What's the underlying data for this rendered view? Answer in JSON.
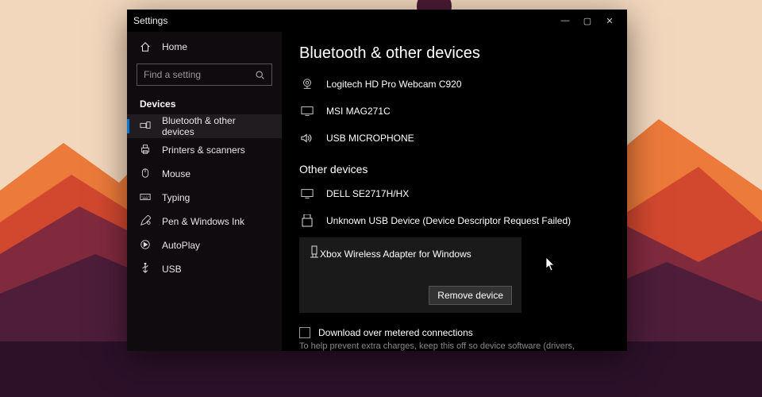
{
  "window": {
    "title": "Settings",
    "controls": {
      "min": "—",
      "max": "▢",
      "close": "✕"
    }
  },
  "sidebar": {
    "home_label": "Home",
    "search_placeholder": "Find a setting",
    "category_header": "Devices",
    "items": [
      {
        "label": "Bluetooth & other devices",
        "icon": "bluetooth-devices-icon",
        "active": true
      },
      {
        "label": "Printers & scanners",
        "icon": "printer-icon"
      },
      {
        "label": "Mouse",
        "icon": "mouse-icon"
      },
      {
        "label": "Typing",
        "icon": "typing-icon"
      },
      {
        "label": "Pen & Windows Ink",
        "icon": "pen-icon"
      },
      {
        "label": "AutoPlay",
        "icon": "autoplay-icon"
      },
      {
        "label": "USB",
        "icon": "usb-icon"
      }
    ]
  },
  "main": {
    "heading": "Bluetooth & other devices",
    "top_devices": [
      {
        "label": "Logitech HD Pro Webcam C920",
        "icon": "webcam-icon"
      },
      {
        "label": "MSI MAG271C",
        "icon": "monitor-icon"
      },
      {
        "label": "USB MICROPHONE",
        "icon": "audio-icon"
      }
    ],
    "other_heading": "Other devices",
    "other_devices": [
      {
        "label": "DELL SE2717H/HX",
        "icon": "monitor-icon"
      },
      {
        "label": "Unknown USB Device (Device Descriptor Request Failed)",
        "icon": "unknown-device-icon"
      }
    ],
    "selected_device": {
      "label": "Xbox Wireless Adapter for Windows",
      "icon": "adapter-icon",
      "remove_label": "Remove device"
    },
    "metered_checkbox_label": "Download over metered connections",
    "metered_desc": "To help prevent extra charges, keep this off so device software (drivers,"
  }
}
